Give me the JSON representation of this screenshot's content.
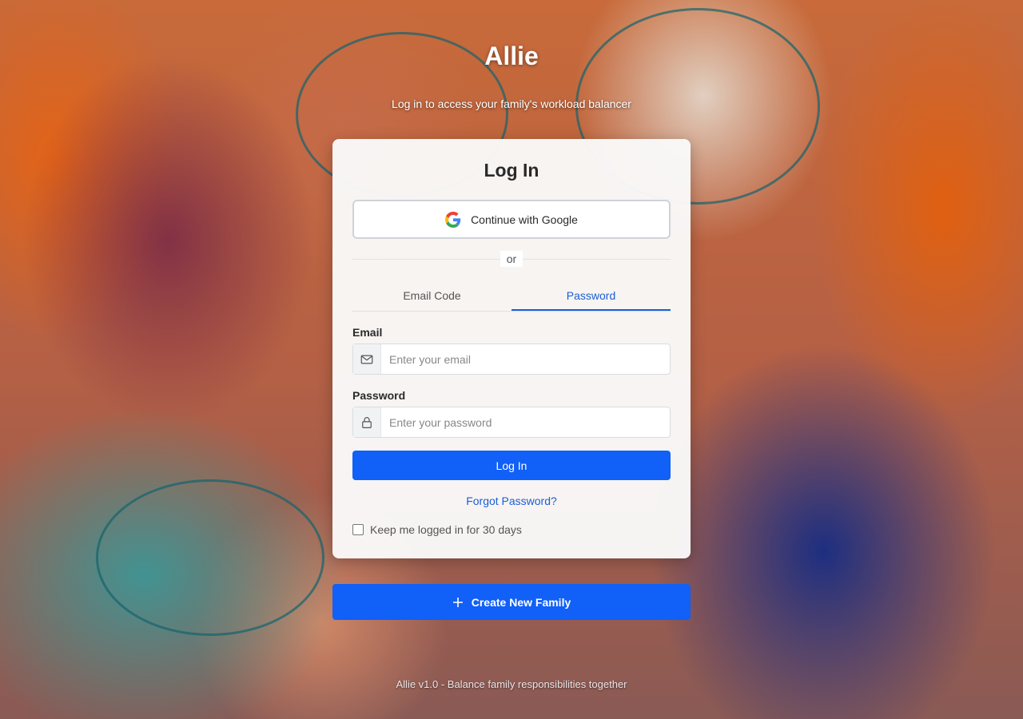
{
  "app": {
    "title": "Allie",
    "subtitle": "Log in to access your family's workload balancer"
  },
  "card": {
    "title": "Log In",
    "google_button": "Continue with Google",
    "divider_text": "or",
    "tabs": [
      {
        "label": "Email Code",
        "active": false
      },
      {
        "label": "Password",
        "active": true
      }
    ],
    "email": {
      "label": "Email",
      "placeholder": "Enter your email",
      "icon": "mail-icon"
    },
    "password": {
      "label": "Password",
      "placeholder": "Enter your password",
      "icon": "lock-icon"
    },
    "login_button": "Log In",
    "forgot_link": "Forgot Password?",
    "remember_label": "Keep me logged in for 30 days",
    "remember_checked": false
  },
  "create_family_button": "Create New Family",
  "footer": "Allie v1.0 - Balance family responsibilities together",
  "colors": {
    "primary": "#1160f7",
    "link": "#1a5fd8"
  }
}
